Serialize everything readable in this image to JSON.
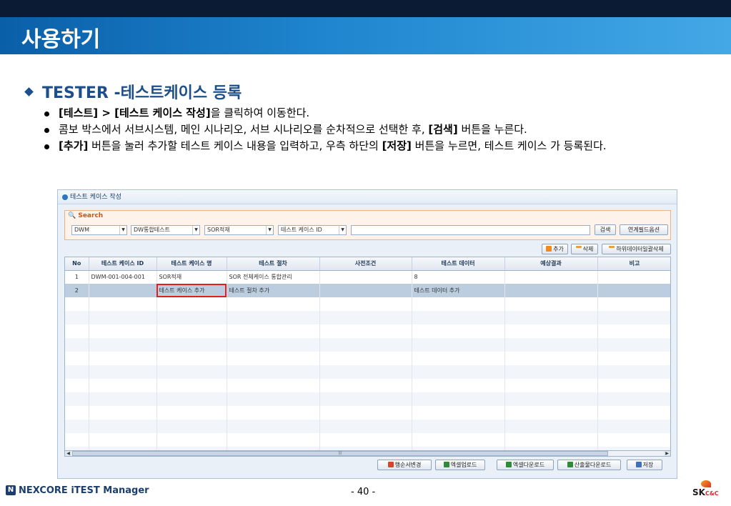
{
  "slide": {
    "title": "사용하기",
    "page_number": "- 40 -"
  },
  "heading": "TESTER -테스트케이스 등록",
  "bullets": [
    {
      "bold1": "[테스트] > [테스트 케이스 작성]",
      "text1": "을 클릭하여 이동한다."
    },
    {
      "text1": "콤보 박스에서 서브시스템, 메인 시나리오, 서브 시나리오를 순차적으로 선택한 후, ",
      "bold1": "[검색]",
      "text2": " 버튼을 누른다."
    },
    {
      "bold1": "[추가]",
      "text1": " 버튼을 눌러 추가할 테스트 케이스 내용을 입력하고, 우측 하단의 ",
      "bold2": "[저장]",
      "text2": " 버튼을 누르면, 테스트 케이스 가 등록된다."
    }
  ],
  "app": {
    "header_title": "테스트 케이스 작성",
    "search_label": "Search",
    "combos": [
      "DWM",
      "DW통합테스트",
      "SOR적재",
      "테스트 케이스 ID"
    ],
    "search_button": "검색",
    "link_field_button": "연계필드옵션",
    "add_button": "추가",
    "delete_button": "삭제",
    "bulk_delete_button": "하위데이터일괄삭제",
    "columns": [
      "No",
      "테스트 케이스 ID",
      "테스트 케이스 명",
      "테스트 절차",
      "사전조건",
      "테스트 데이터",
      "예상결과",
      "비고"
    ],
    "rows": [
      [
        "1",
        "DWM-001-004-001",
        "SOR적재",
        "SOR 전체케이스 통합관리",
        "",
        "8",
        "",
        ""
      ],
      [
        "2",
        "",
        "테스트 케이스 추가",
        "테스트 절차 추가",
        "",
        "테스트 데이터 추가",
        "",
        ""
      ]
    ],
    "bottom_buttons": [
      "행순서변경",
      "엑셀업로드",
      "엑셀다운로드",
      "산출물다운로드",
      "저장"
    ]
  },
  "footer": {
    "product": "NEXCORE iTEST Manager",
    "company": "SK",
    "company_sub": "C&C"
  },
  "colors": {
    "title_bar": "#1f86cf",
    "heading": "#1d4f8b",
    "selected_row": "#bccde0",
    "highlight_border": "#e02020"
  }
}
